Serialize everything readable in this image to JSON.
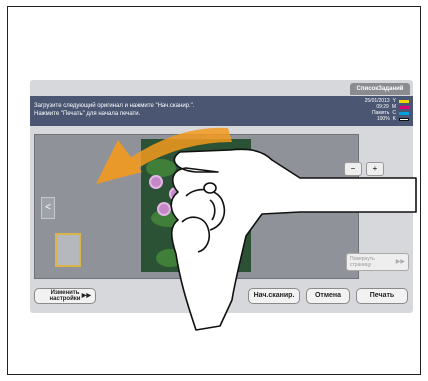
{
  "tab": {
    "label": "СписокЗаданий"
  },
  "message": {
    "line1": "Загрузите следующий оригинал и нажмите \"Нач.сканир.\".",
    "line2": "Нажмите \"Печать\" для начала печати."
  },
  "status": {
    "date": "25/01/2013",
    "time": "09:29",
    "memory_label": "Память",
    "memory_value": "100%",
    "toner_y": "Y",
    "toner_m": "M",
    "toner_c": "C",
    "toner_k": "K"
  },
  "buttons": {
    "change_settings_line1": "Изменить",
    "change_settings_line2": "настройки",
    "start_scan": "Нач.сканир.",
    "cancel": "Отмена",
    "print": "Печать",
    "rotate_line1": "Повернуть",
    "rotate_line2": "страницу",
    "nav_left": "<",
    "zoom_out": "−",
    "zoom_in": "+"
  },
  "colors": {
    "message_bar": "#4a5672",
    "arrow": "#f39a1e",
    "toner_y": "#f0d800",
    "toner_m": "#e0007a",
    "toner_c": "#00a0e0",
    "toner_k": "#111111"
  },
  "icons": [
    "arrow-left-icon",
    "zoom-out-icon",
    "zoom-in-icon",
    "chevron-right-icon",
    "hand-gesture-icon",
    "swipe-arrow-icon"
  ]
}
